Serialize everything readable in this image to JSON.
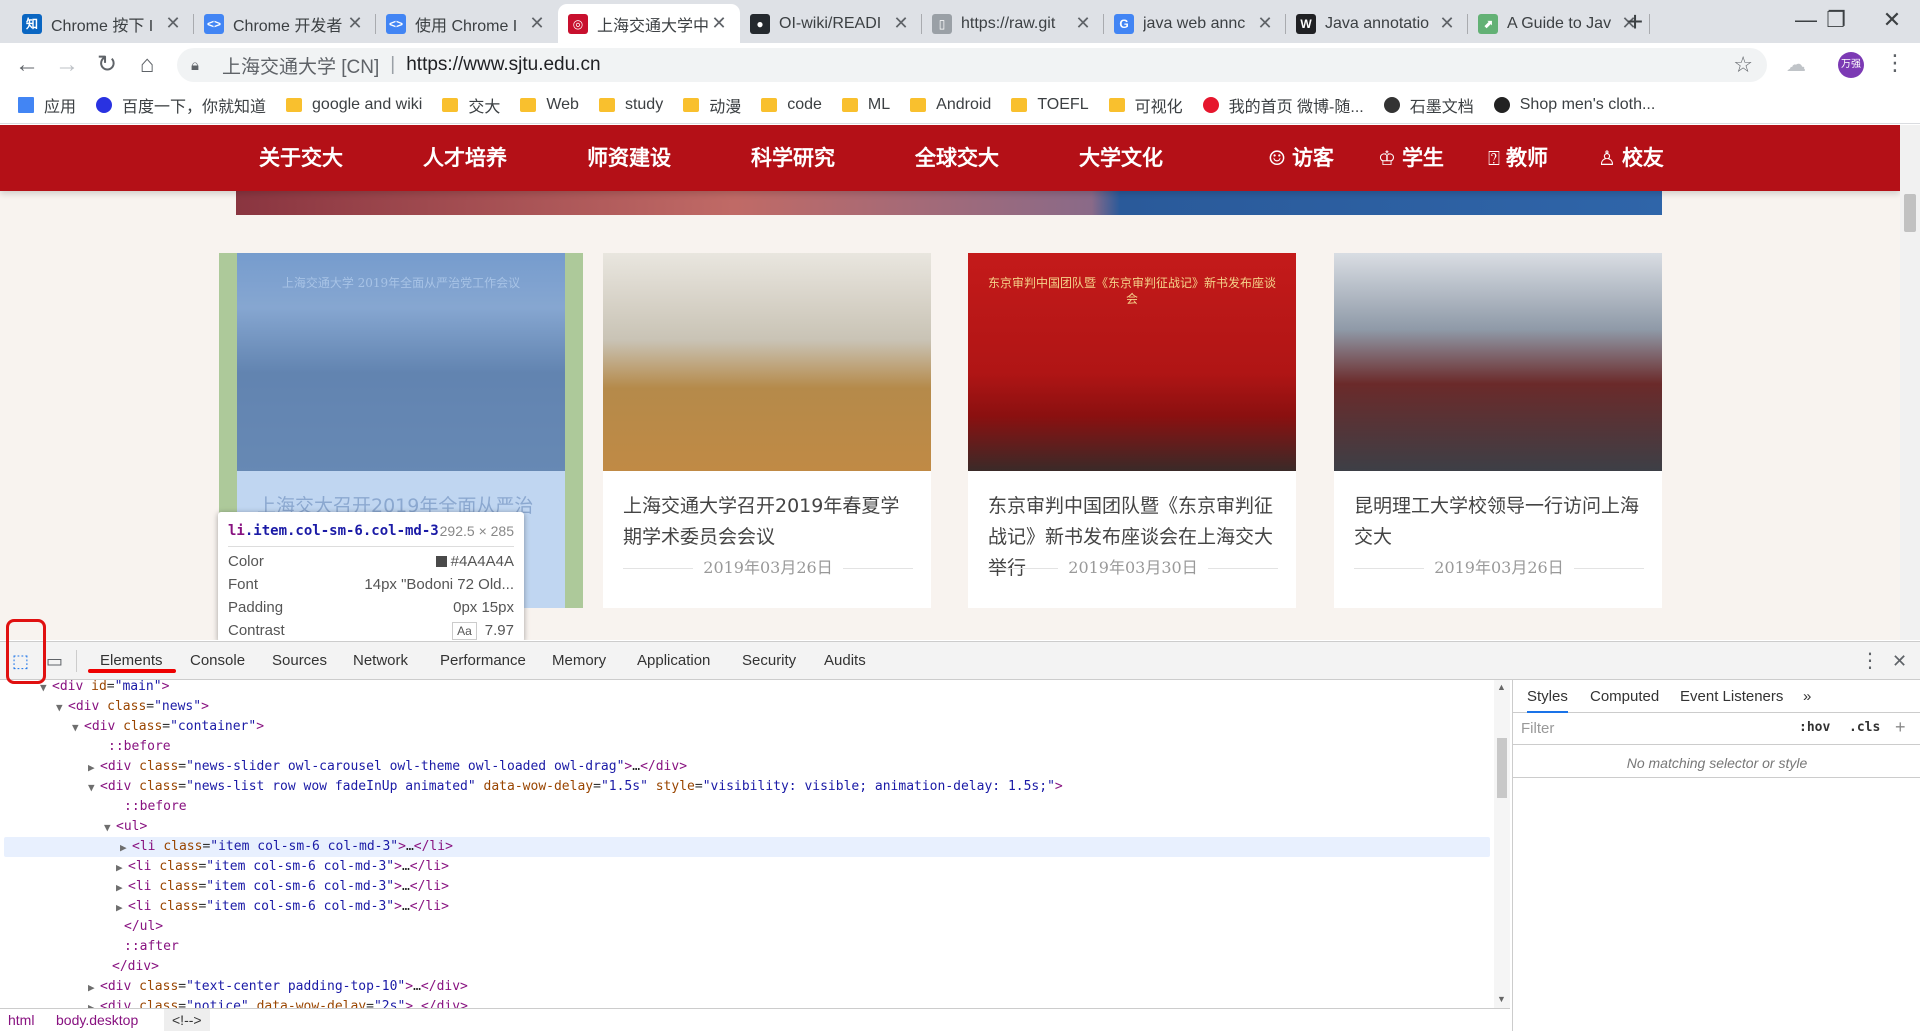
{
  "tabs": [
    {
      "title": "Chrome 按下 I",
      "icon": "zhihu-icon",
      "color": "#0a66c2",
      "glyph": "知"
    },
    {
      "title": "Chrome 开发者",
      "icon": "devtools-icon",
      "color": "#4285f4",
      "glyph": "<>"
    },
    {
      "title": "使用 Chrome I",
      "icon": "devtools-icon",
      "color": "#4285f4",
      "glyph": "<>"
    },
    {
      "title": "上海交通大学中",
      "icon": "sjtu-icon",
      "color": "#c8102e",
      "glyph": "◎"
    },
    {
      "title": "OI-wiki/READI",
      "icon": "github-icon",
      "color": "#24292e",
      "glyph": "●"
    },
    {
      "title": "https://raw.git",
      "icon": "page-icon",
      "color": "#9aa0a6",
      "glyph": "▯"
    },
    {
      "title": "java web annc",
      "icon": "google-icon",
      "color": "#4285f4",
      "glyph": "G"
    },
    {
      "title": "Java annotatio",
      "icon": "wikipedia-icon",
      "color": "#202124",
      "glyph": "W"
    },
    {
      "title": "A Guide to Jav",
      "icon": "baeldung-icon",
      "color": "#63b175",
      "glyph": "⬈"
    }
  ],
  "window_controls": {
    "minimize": "—",
    "maximize": "❐",
    "close": "✕"
  },
  "omnibox": {
    "site": "上海交通大学 [CN]",
    "separator": "|",
    "url": "https://www.sjtu.edu.cn"
  },
  "profile_avatar_text": "万强",
  "bookmarks": [
    {
      "label": "应用",
      "icon": "apps-grid-icon"
    },
    {
      "label": "百度一下，你就知道",
      "icon": "baidu-paw-icon"
    },
    {
      "label": "google and wiki",
      "icon": "folder-icon"
    },
    {
      "label": "交大",
      "icon": "folder-icon"
    },
    {
      "label": "Web",
      "icon": "folder-icon"
    },
    {
      "label": "study",
      "icon": "folder-icon"
    },
    {
      "label": "动漫",
      "icon": "folder-icon"
    },
    {
      "label": "code",
      "icon": "folder-icon"
    },
    {
      "label": "ML",
      "icon": "folder-icon"
    },
    {
      "label": "Android",
      "icon": "folder-icon"
    },
    {
      "label": "TOEFL",
      "icon": "folder-icon"
    },
    {
      "label": "可视化",
      "icon": "folder-icon"
    },
    {
      "label": "我的首页 微博-随...",
      "icon": "weibo-icon"
    },
    {
      "label": "石墨文档",
      "icon": "shimo-icon"
    },
    {
      "label": "Shop men's cloth...",
      "icon": "shop-icon"
    }
  ],
  "site_nav": {
    "main": [
      "关于交大",
      "人才培养",
      "师资建设",
      "科学研究",
      "全球交大",
      "大学文化"
    ],
    "audience": [
      {
        "label": "访客",
        "icon": "visitor-icon",
        "glyph": "☺"
      },
      {
        "label": "学生",
        "icon": "graduation-cap-icon",
        "glyph": "♔"
      },
      {
        "label": "教师",
        "icon": "teacher-board-icon",
        "glyph": "⍰"
      },
      {
        "label": "校友",
        "icon": "alumni-icon",
        "glyph": "♙"
      }
    ]
  },
  "news": [
    {
      "caption": "上海交大召开2019年全面从严治党工",
      "date": "",
      "photo_caption": "上海交通大学 2019年全面从严治党工作会议"
    },
    {
      "caption": "上海交通大学召开2019年春夏学期学术委员会会议",
      "date": "2019年03月26日"
    },
    {
      "caption": "东京审判中国团队暨《东京审判征战记》新书发布座谈会在上海交大举行",
      "date": "2019年03月30日",
      "photo_caption": "东京审判中国团队暨《东京审判征战记》新书发布座谈会"
    },
    {
      "caption": "昆明理工大学校领导一行访问上海交大",
      "date": "2019年03月26日"
    }
  ],
  "tooltip": {
    "selector_tag": "li",
    "selector_classes": ".item.col-sm-6.col-md-3",
    "size": "292.5 × 285",
    "color_label": "Color",
    "color_value": "#4A4A4A",
    "font_label": "Font",
    "font_value": "14px \"Bodoni 72 Old...",
    "padding_label": "Padding",
    "padding_value": "0px 15px",
    "contrast_label": "Contrast",
    "contrast_badge": "Aa",
    "contrast_value": "7.97"
  },
  "devtools": {
    "tabs": [
      "Elements",
      "Console",
      "Sources",
      "Network",
      "Performance",
      "Memory",
      "Application",
      "Security",
      "Audits"
    ],
    "active_tab": "Elements",
    "styles_tabs": [
      "Styles",
      "Computed",
      "Event Listeners",
      "»"
    ],
    "filter_placeholder": "Filter",
    "hov": ":hov",
    "cls": ".cls",
    "plus": "+",
    "no_match": "No matching selector or style",
    "breadcrumbs": [
      "html",
      "body.desktop",
      "<!-->"
    ]
  },
  "dom_lines": [
    {
      "arrow": "▼",
      "html": "<span class='tag'>&lt;div</span> <span class='an'>id</span>=<span class='av'>\"main\"</span><span class='tag'>&gt;</span>"
    },
    {
      "arrow": "▼",
      "html": "<span class='tag'>&lt;div</span> <span class='an'>class</span>=<span class='av'>\"news\"</span><span class='tag'>&gt;</span>"
    },
    {
      "arrow": "▼",
      "html": "<span class='tag'>&lt;div</span> <span class='an'>class</span>=<span class='av'>\"container\"</span><span class='tag'>&gt;</span>"
    },
    {
      "arrow": "",
      "html": "<span class='ps'>::before</span>"
    },
    {
      "arrow": "▶",
      "html": "<span class='tag'>&lt;div</span> <span class='an'>class</span>=<span class='av'>\"news-slider owl-carousel owl-theme owl-loaded owl-drag\"</span><span class='tag'>&gt;</span><span class='tx'>…</span><span class='tag'>&lt;/div&gt;</span>"
    },
    {
      "arrow": "▼",
      "html": "<span class='tag'>&lt;div</span> <span class='an'>class</span>=<span class='av'>\"news-list row wow fadeInUp animated\"</span> <span class='an'>data-wow-delay</span>=<span class='av'>\"1.5s\"</span> <span class='an'>style</span>=<span class='av'>\"visibility: visible; animation-delay: 1.5s;\"</span><span class='tag'>&gt;</span>"
    },
    {
      "arrow": "",
      "html": "<span class='ps'>::before</span>"
    },
    {
      "arrow": "▼",
      "html": "<span class='tag'>&lt;ul&gt;</span>"
    },
    {
      "arrow": "▶",
      "html": "<span class='tag'>&lt;li</span> <span class='an'>class</span>=<span class='av'>\"item col-sm-6 col-md-3\"</span><span class='tag'>&gt;</span><span class='tx'>…</span><span class='tag'>&lt;/li&gt;</span>"
    },
    {
      "arrow": "▶",
      "html": "<span class='tag'>&lt;li</span> <span class='an'>class</span>=<span class='av'>\"item col-sm-6 col-md-3\"</span><span class='tag'>&gt;</span><span class='tx'>…</span><span class='tag'>&lt;/li&gt;</span>"
    },
    {
      "arrow": "▶",
      "html": "<span class='tag'>&lt;li</span> <span class='an'>class</span>=<span class='av'>\"item col-sm-6 col-md-3\"</span><span class='tag'>&gt;</span><span class='tx'>…</span><span class='tag'>&lt;/li&gt;</span>"
    },
    {
      "arrow": "▶",
      "html": "<span class='tag'>&lt;li</span> <span class='an'>class</span>=<span class='av'>\"item col-sm-6 col-md-3\"</span><span class='tag'>&gt;</span><span class='tx'>…</span><span class='tag'>&lt;/li&gt;</span>"
    },
    {
      "arrow": "",
      "html": "<span class='tag'>&lt;/ul&gt;</span>"
    },
    {
      "arrow": "",
      "html": "<span class='ps'>::after</span>"
    },
    {
      "arrow": "",
      "html": "<span class='tag'>&lt;/div&gt;</span>"
    },
    {
      "arrow": "▶",
      "html": "<span class='tag'>&lt;div</span> <span class='an'>class</span>=<span class='av'>\"text-center padding-top-10\"</span><span class='tag'>&gt;</span><span class='tx'>…</span><span class='tag'>&lt;/div&gt;</span>"
    },
    {
      "arrow": "▶",
      "html": "<span class='tag'>&lt;div</span> <span class='an'>class</span>=<span class='av'>\"notice\"</span> <span class='an'>data-wow-delay</span>=<span class='av'>\"2s\"</span><span class='tag'>&gt;</span><span class='tx'>…</span><span class='tag'>&lt;/div&gt;</span>"
    }
  ],
  "selected_dom_line": 8
}
